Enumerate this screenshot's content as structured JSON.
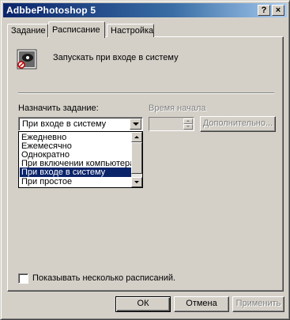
{
  "window": {
    "title": "AdbbePhotoshop 5",
    "help_label": "?",
    "close_label": "×"
  },
  "tabs": [
    {
      "label": "Задание"
    },
    {
      "label": "Расписание"
    },
    {
      "label": "Настройка"
    }
  ],
  "schedule": {
    "headline": "Запускать при входе в систему",
    "task_label": "Назначить задание:",
    "time_label": "Время начала",
    "selected": "При входе в систему",
    "options": [
      "Ежедневно",
      "Ежемесячно",
      "Однократно",
      "При включении компьютера",
      "При входе в систему",
      "При простое"
    ],
    "selected_index": 4,
    "more_button": "Дополнительно...",
    "multi_checkbox_label": "Показывать несколько расписаний."
  },
  "buttons": {
    "ok": "ОК",
    "cancel": "Отмена",
    "apply": "Применить"
  }
}
